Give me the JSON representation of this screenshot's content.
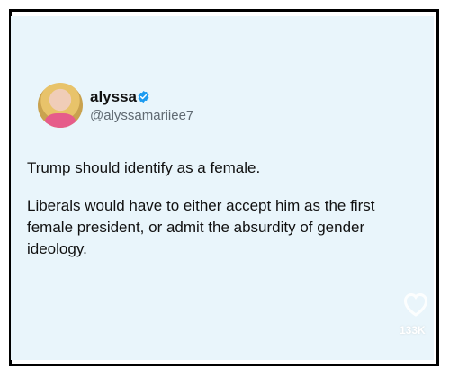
{
  "tweet": {
    "display_name": "alyssa",
    "handle": "@alyssamariiee7",
    "paragraph_1": "Trump should identify as a female.",
    "paragraph_2": "Liberals would have to either accept him as the first female president, or admit the absurdity of gender ideology.",
    "like_count": "133K",
    "icons": {
      "verified": "verified-check-icon",
      "like": "heart-icon"
    },
    "colors": {
      "card_background": "#e9f5fb",
      "verified_badge": "#1d9bf0",
      "frame_border": "#000000"
    }
  }
}
